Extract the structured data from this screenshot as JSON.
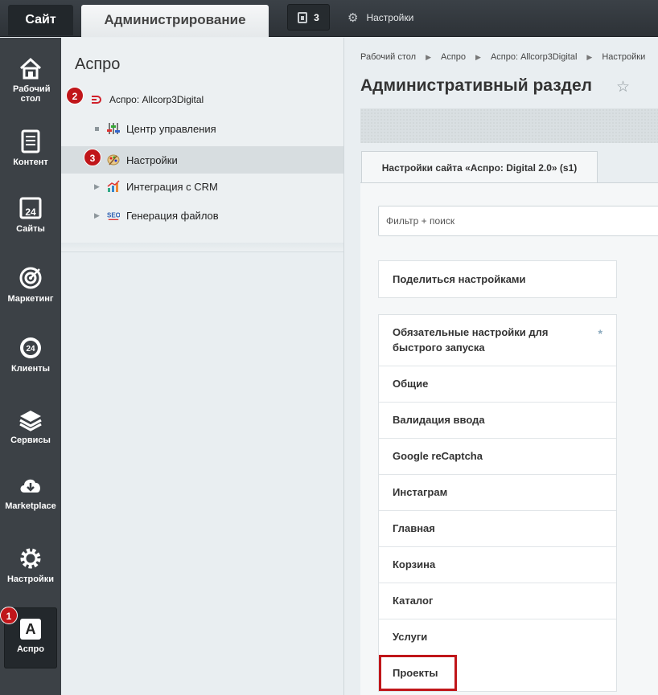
{
  "topbar": {
    "site_tab": "Сайт",
    "admin_tab": "Администрирование",
    "notifications_count": "3",
    "settings_label": "Настройки"
  },
  "leftmenu": {
    "items": [
      {
        "label": "Рабочий стол",
        "icon": "home-icon"
      },
      {
        "label": "Контент",
        "icon": "document-icon"
      },
      {
        "label": "Сайты",
        "icon": "calendar-24-icon"
      },
      {
        "label": "Маркетинг",
        "icon": "target-icon"
      },
      {
        "label": "Клиенты",
        "icon": "clients-24-icon"
      },
      {
        "label": "Сервисы",
        "icon": "layers-icon"
      },
      {
        "label": "Marketplace",
        "icon": "cloud-download-icon"
      },
      {
        "label": "Настройки",
        "icon": "gear-icon"
      },
      {
        "label": "Аспро",
        "icon": "aspro-a-icon"
      }
    ],
    "active_index": 8
  },
  "badges": {
    "b1": "1",
    "b2": "2",
    "b3": "3"
  },
  "tree": {
    "title": "Аспро",
    "root": "Аспро: Allcorp3Digital",
    "items": [
      {
        "label": "Центр управления",
        "icon": "control-center-icon",
        "marker": "dot"
      },
      {
        "label": "Настройки",
        "icon": "palette-icon",
        "marker": "none",
        "selected": true
      },
      {
        "label": "Интеграция с CRM",
        "icon": "crm-chart-icon",
        "marker": "arrow"
      },
      {
        "label": "Генерация файлов",
        "icon": "seo-icon",
        "marker": "arrow"
      }
    ]
  },
  "content": {
    "breadcrumb": [
      "Рабочий стол",
      "Аспро",
      "Аспро: Allcorp3Digital",
      "Настройки"
    ],
    "title": "Административный раздел",
    "tab": "Настройки сайта «Аспро: Digital 2.0» (s1)",
    "filter_placeholder": "Фильтр + поиск",
    "share": "Поделиться настройками",
    "settings": [
      "Обязательные настройки для быстрого запуска",
      "Общие",
      "Валидация ввода",
      "Google reCaptcha",
      "Инстаграм",
      "Главная",
      "Корзина",
      "Каталог",
      "Услуги",
      "Проекты"
    ],
    "required_marker": "*"
  },
  "colors": {
    "badge": "#c0161a",
    "topbar": "#2d3237",
    "leftmenu": "#3c4146"
  }
}
